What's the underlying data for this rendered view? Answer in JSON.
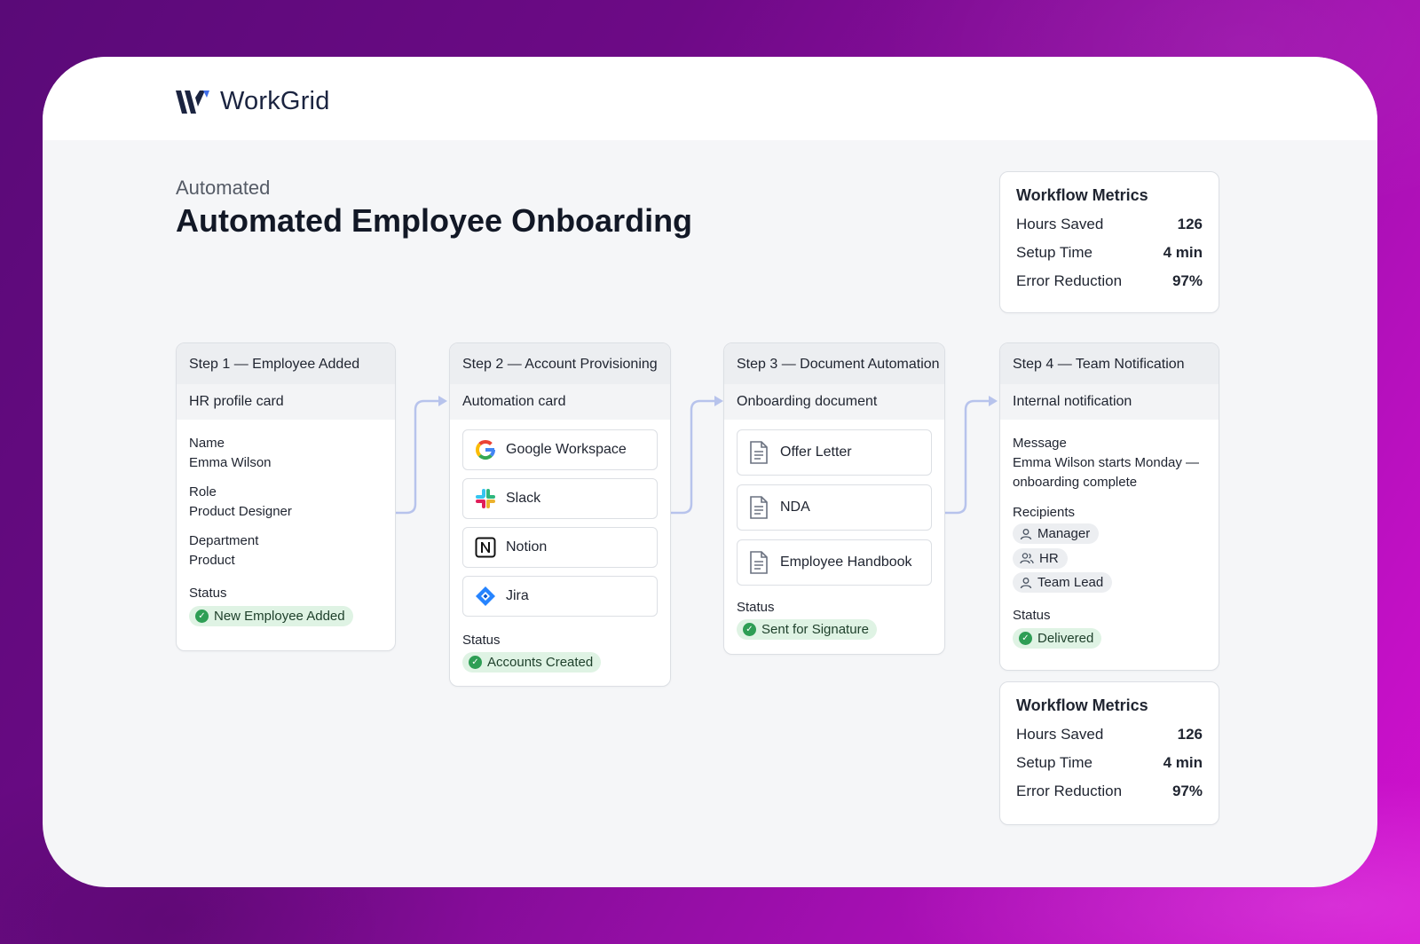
{
  "brand": {
    "name": "WorkGrid"
  },
  "header": {
    "eyebrow": "Automated",
    "title": "Automated Employee Onboarding"
  },
  "metrics_top": {
    "title": "Workflow Metrics",
    "rows": [
      {
        "label": "Hours Saved",
        "value": "126"
      },
      {
        "label": "Setup Time",
        "value": "4 min"
      },
      {
        "label": "Error Reduction",
        "value": "97%"
      }
    ]
  },
  "metrics_bottom": {
    "title": "Workflow Metrics",
    "rows": [
      {
        "label": "Hours Saved",
        "value": "126"
      },
      {
        "label": "Setup Time",
        "value": "4 min"
      },
      {
        "label": "Error Reduction",
        "value": "97%"
      }
    ]
  },
  "step1": {
    "title": "Step 1 — Employee Added",
    "subtitle": "HR profile card",
    "fields": [
      {
        "label": "Name",
        "value": "Emma Wilson"
      },
      {
        "label": "Role",
        "value": "Product Designer"
      },
      {
        "label": "Department",
        "value": "Product"
      }
    ],
    "status_label": "Status",
    "status": "New Employee Added"
  },
  "step2": {
    "title": "Step 2 — Account Provisioning",
    "subtitle": "Automation card",
    "apps": [
      {
        "name": "Google Workspace",
        "icon": "google-icon"
      },
      {
        "name": "Slack",
        "icon": "slack-icon"
      },
      {
        "name": "Notion",
        "icon": "notion-icon"
      },
      {
        "name": "Jira",
        "icon": "jira-icon"
      }
    ],
    "status_label": "Status",
    "status": "Accounts Created"
  },
  "step3": {
    "title": "Step 3 — Document Automation",
    "subtitle": "Onboarding document",
    "documents": [
      "Offer Letter",
      "NDA",
      "Employee Handbook"
    ],
    "status_label": "Status",
    "status": "Sent for Signature"
  },
  "step4": {
    "title": "Step 4 — Team Notification",
    "subtitle": "Internal notification",
    "message_label": "Message",
    "message": "Emma Wilson starts Monday — onboarding complete",
    "recipients_label": "Recipients",
    "recipients": [
      "Manager",
      "HR",
      "Team Lead"
    ],
    "status_label": "Status",
    "status": "Delivered"
  },
  "colors": {
    "connector": "#b7c3ec",
    "badge_bg": "#dff3e4",
    "check": "#2e9e55",
    "brand": "#1b2440"
  }
}
